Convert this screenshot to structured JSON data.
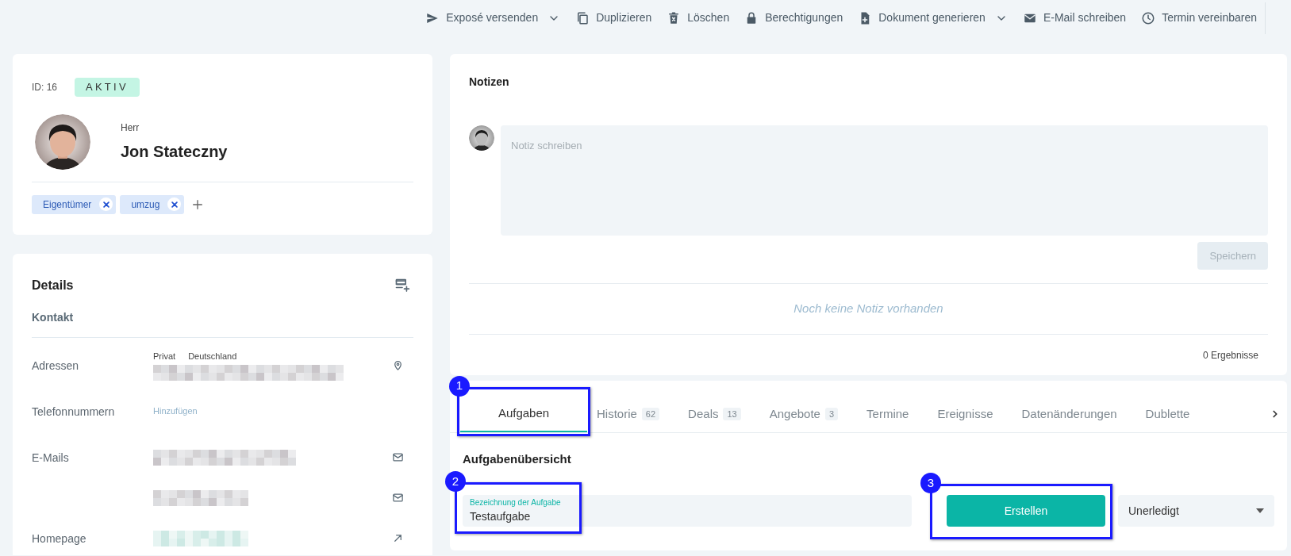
{
  "toolbar": {
    "actions": [
      {
        "label": "Exposé versenden",
        "dropdown": true
      },
      {
        "label": "Duplizieren",
        "dropdown": false
      },
      {
        "label": "Löschen",
        "dropdown": false
      },
      {
        "label": "Berechtigungen",
        "dropdown": false
      },
      {
        "label": "Dokument generieren",
        "dropdown": true
      },
      {
        "label": "E-Mail schreiben",
        "dropdown": false
      },
      {
        "label": "Termin vereinbaren",
        "dropdown": false
      }
    ]
  },
  "contact": {
    "id": "ID: 16",
    "status": "AKTIV",
    "salutation": "Herr",
    "name": "Jon Stateczny",
    "tags": [
      {
        "label": "Eigentümer"
      },
      {
        "label": "umzug"
      }
    ]
  },
  "details": {
    "title": "Details",
    "section": "Kontakt",
    "rows": [
      {
        "kind": "address",
        "label": "Adressen",
        "type": "Privat",
        "country": "Deutschland",
        "redacted": true
      },
      {
        "kind": "link",
        "label": "Telefonnummern",
        "value": "Hinzufügen"
      },
      {
        "kind": "email",
        "label": "E-Mails",
        "redacted": true
      },
      {
        "kind": "email",
        "redacted": true
      },
      {
        "kind": "homepage",
        "label": "Homepage",
        "redacted": true
      }
    ]
  },
  "notes": {
    "title": "Notizen",
    "placeholder": "Notiz schreiben",
    "save_button": {
      "label": "Speichern",
      "disabled": true
    },
    "empty_text": "Noch keine Notiz vorhanden",
    "result_count": "0 Ergebnisse"
  },
  "tabs": [
    {
      "label": "Aufgaben",
      "selected": true,
      "callout": "1"
    },
    {
      "label": "Historie",
      "count": "62",
      "selected": false
    },
    {
      "label": "Deals",
      "count": "13",
      "selected": false
    },
    {
      "label": "Angebote",
      "count": "3",
      "selected": false
    },
    {
      "label": "Termine",
      "selected": false
    },
    {
      "label": "Ereignisse",
      "selected": false
    },
    {
      "label": "Datenänderungen",
      "selected": false
    },
    {
      "label": "Dublette",
      "selected": false
    }
  ],
  "tasks": {
    "title": "Aufgabenübersicht",
    "field": {
      "label": "Bezeichnung der Aufgabe",
      "value": "Testaufgabe",
      "callout": "2"
    },
    "create_button": {
      "label": "Erstellen",
      "callout": "3"
    },
    "status_select": {
      "value": "Unerledigt"
    }
  }
}
